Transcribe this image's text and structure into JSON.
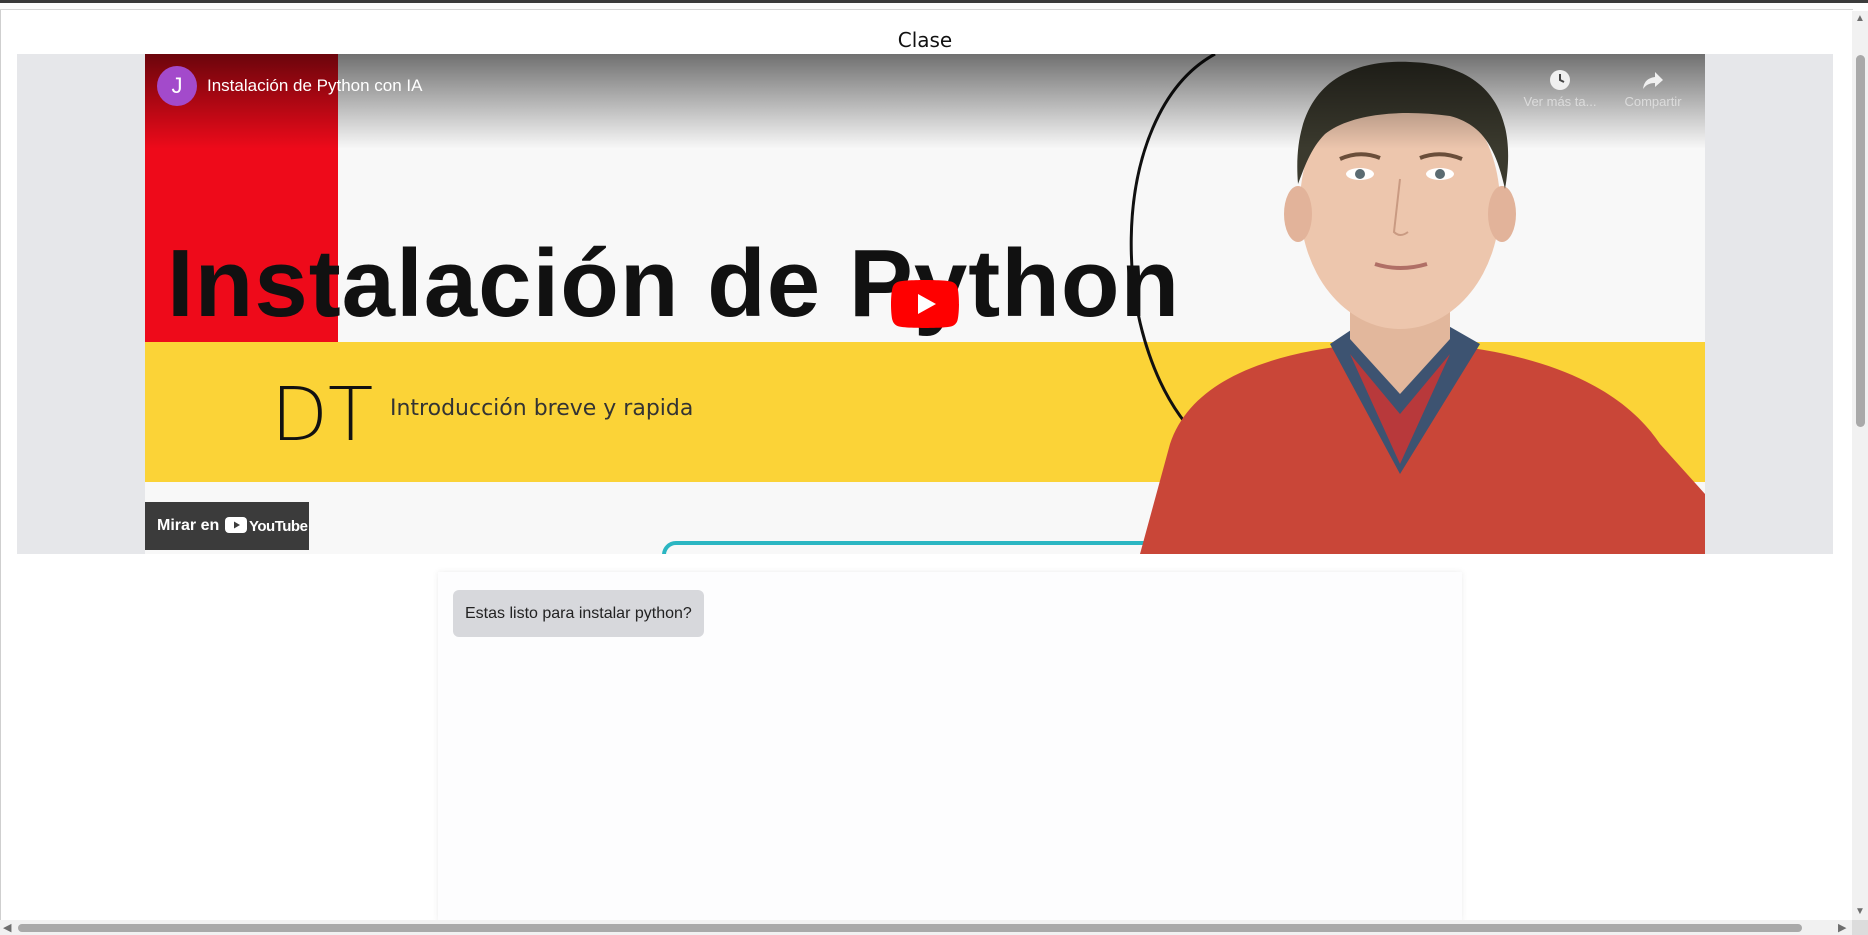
{
  "page": {
    "title": "Clase"
  },
  "video": {
    "channel_initial": "J",
    "title": "Instalación de Python con IA",
    "watch_later_label": "Ver más ta...",
    "share_label": "Compartir",
    "watch_on_label": "Mirar en",
    "youtube_word": "YouTube",
    "thumbnail": {
      "headline": "Instalación de Python",
      "logo_text": "DT",
      "subtitle": "Introducción breve y rapida"
    },
    "colors": {
      "red": "#ee0a1a",
      "yellow": "#fbd337",
      "avatar": "#a34acb",
      "play": "#ff0000"
    }
  },
  "chat": {
    "messages": [
      {
        "text": "Estas listo para instalar python?"
      }
    ]
  }
}
